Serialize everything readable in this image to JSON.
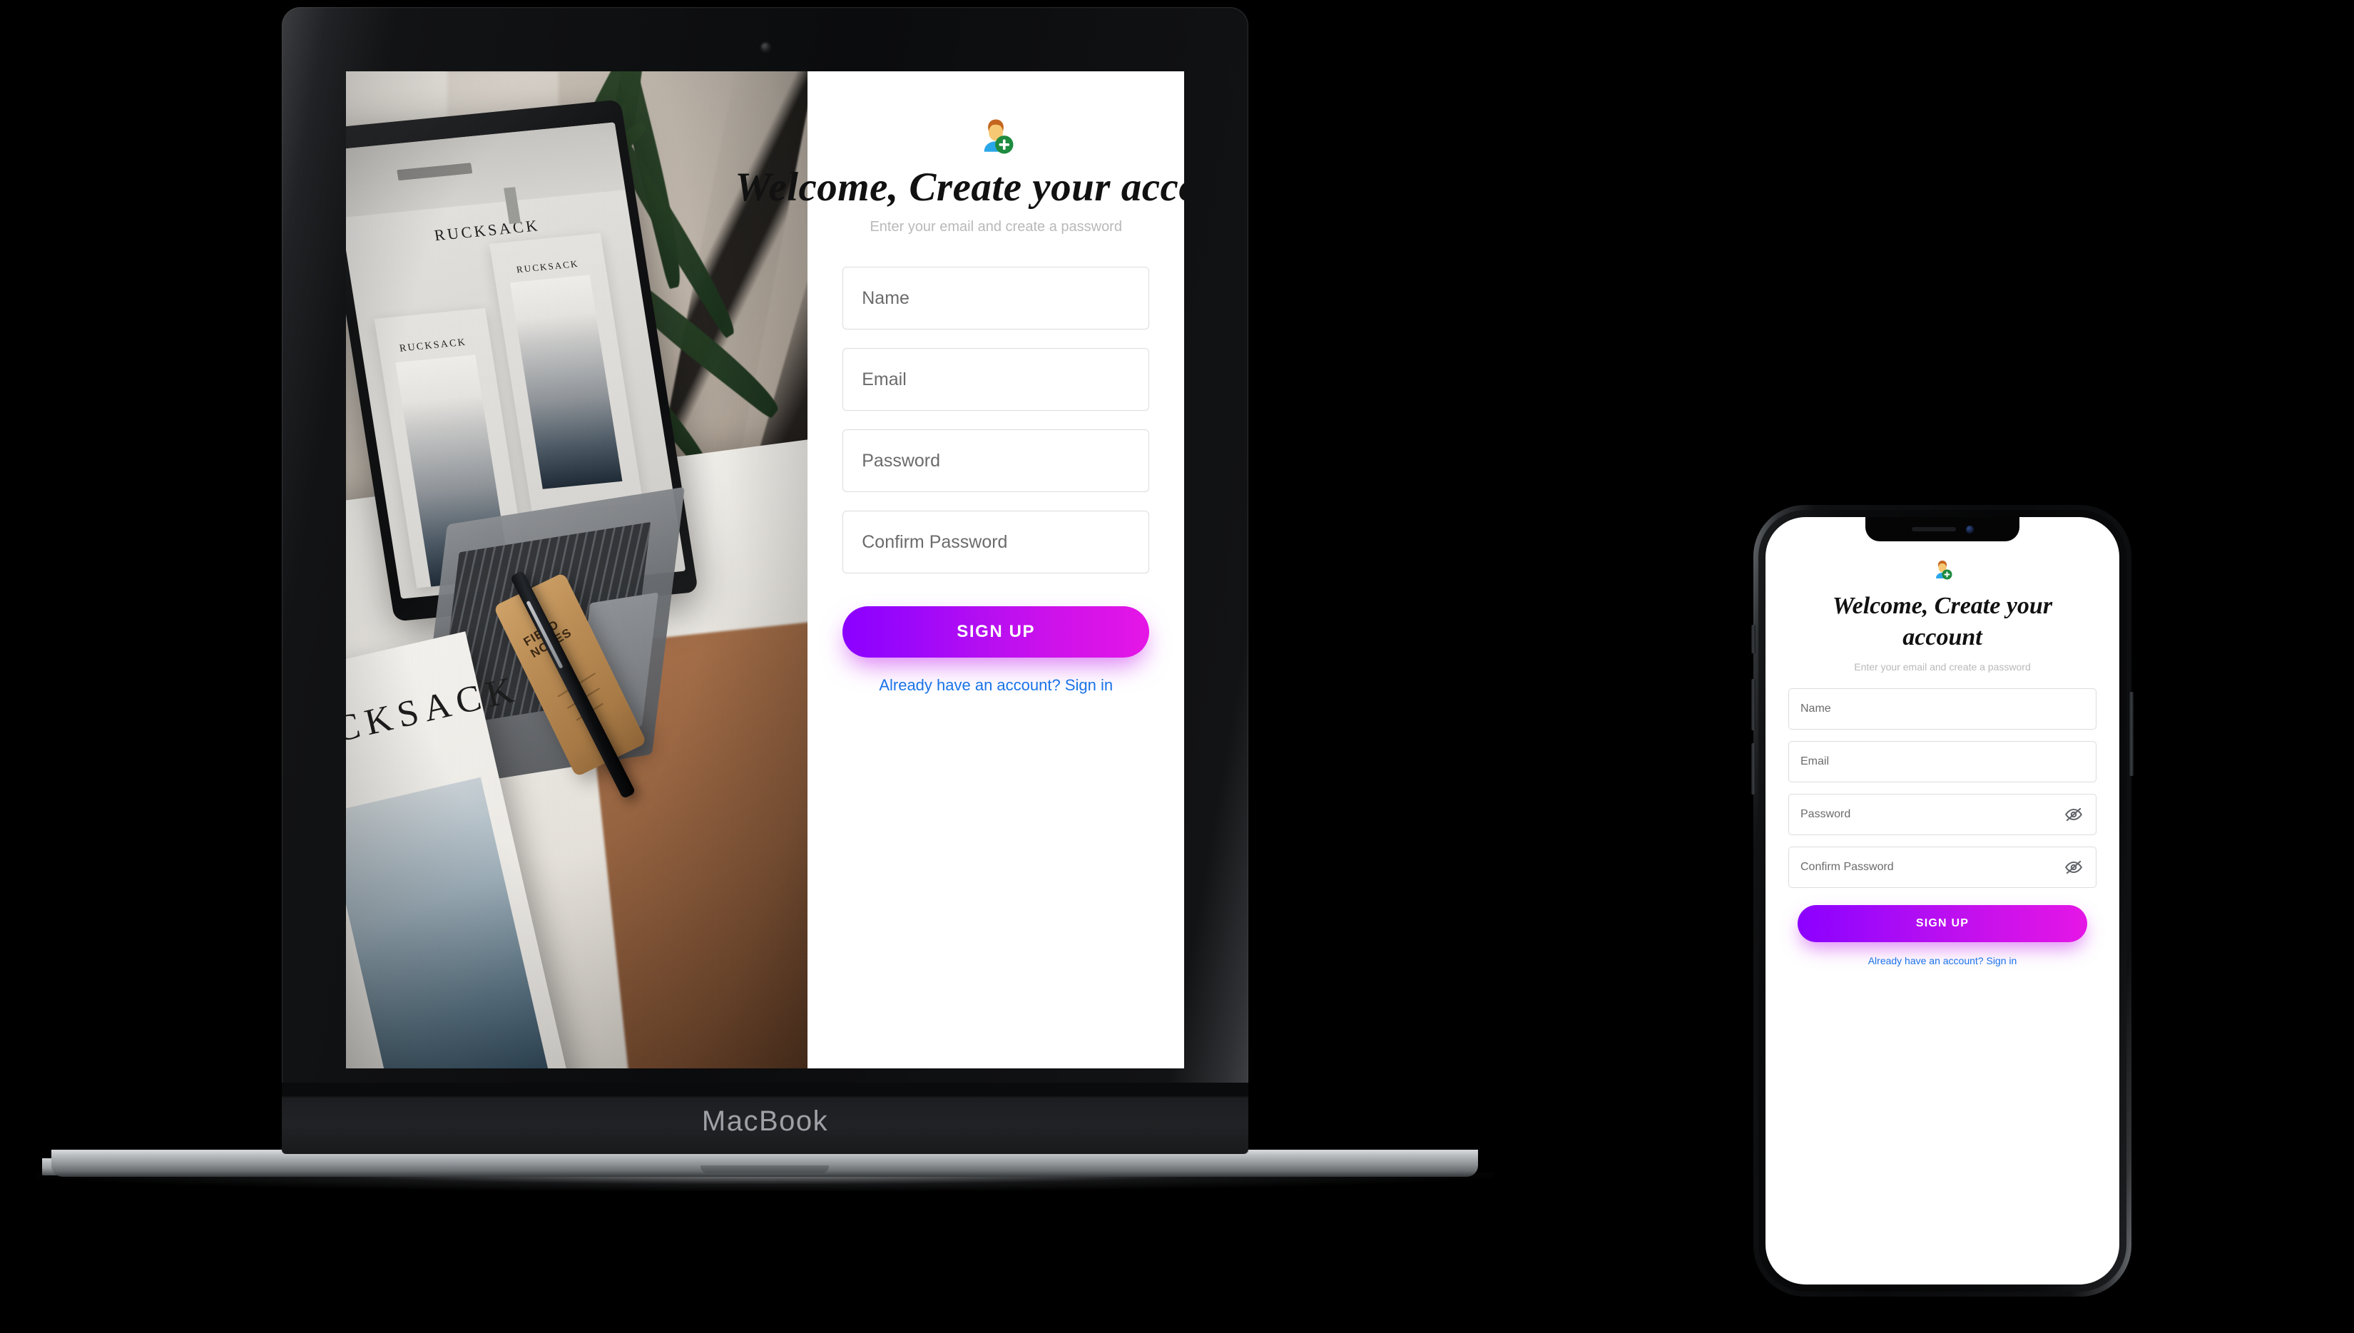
{
  "device_labels": {
    "macbook": "MacBook"
  },
  "desktop": {
    "avatar_icon": "user-add-emoji",
    "heading": "Welcome, Create your account",
    "subheading": "Enter your email and create a password",
    "fields": [
      {
        "placeholder": "Name",
        "name": "name",
        "has_eye": false
      },
      {
        "placeholder": "Email",
        "name": "email",
        "has_eye": false
      },
      {
        "placeholder": "Password",
        "name": "password",
        "has_eye": false
      },
      {
        "placeholder": "Confirm Password",
        "name": "confirm-password",
        "has_eye": false
      }
    ],
    "submit_label": "SIGN UP",
    "signin_text": "Already have an account? Sign in"
  },
  "mobile": {
    "avatar_icon": "user-add-emoji",
    "heading": "Welcome, Create your account",
    "subheading": "Enter your email and create a password",
    "fields": [
      {
        "placeholder": "Name",
        "name": "name",
        "has_eye": false
      },
      {
        "placeholder": "Email",
        "name": "email",
        "has_eye": false
      },
      {
        "placeholder": "Password",
        "name": "password",
        "has_eye": true
      },
      {
        "placeholder": "Confirm Password",
        "name": "confirm-password",
        "has_eye": true
      }
    ],
    "submit_label": "SIGN UP",
    "signin_text": "Already have an account? Sign in"
  },
  "photo": {
    "brand_text": "RUCKSACK",
    "poster_text_1": "RUCKSACK",
    "poster_text_2": "RUCKSACK",
    "frame_text": "RUCKSACK",
    "notebook_line1": "FIELD",
    "notebook_line2": "NOTES"
  },
  "colors": {
    "gradient_start": "#8b00ff",
    "gradient_end": "#e516e6",
    "link": "#1a73e8",
    "placeholder": "#6b6b6b",
    "subheading": "#b9b9b9",
    "field_border": "#dcdcdc",
    "background": "#000000",
    "panel": "#ffffff"
  }
}
